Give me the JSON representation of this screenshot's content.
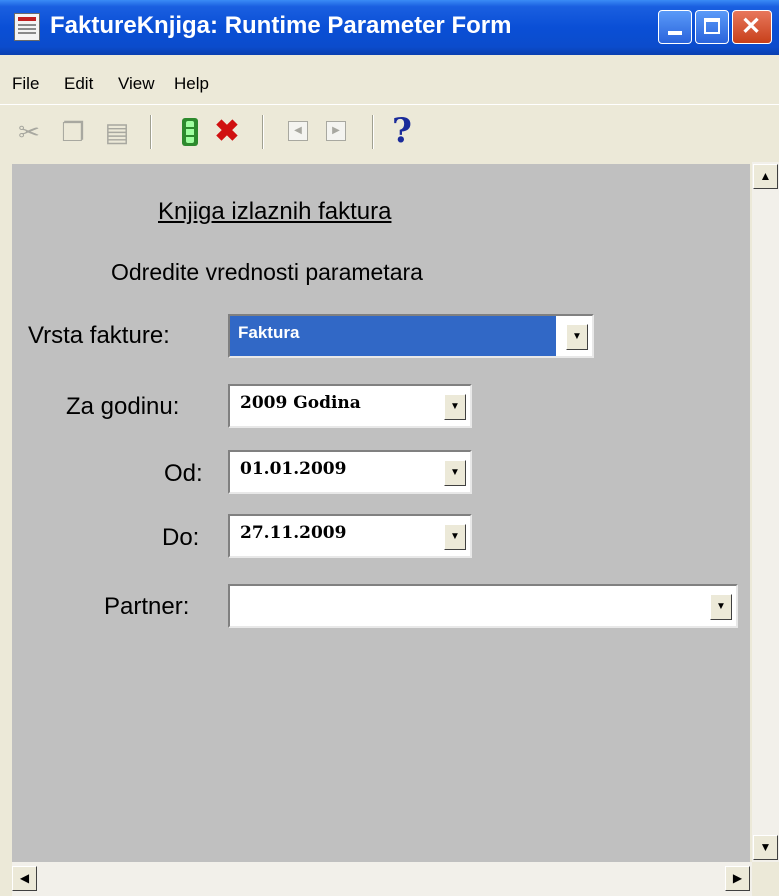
{
  "window": {
    "title": "FaktureKnjiga: Runtime Parameter Form"
  },
  "menu": [
    "File",
    "Edit",
    "View",
    "Help"
  ],
  "icons": {
    "app": "report-app-icon",
    "cut": "scissors-icon",
    "copy": "copy-icon",
    "paste": "paste-icon",
    "run": "traffic-light-icon",
    "cancel": "red-x-icon",
    "prev": "previous-page-icon",
    "next": "next-page-icon",
    "help": "question-mark-icon"
  },
  "form": {
    "heading": "Knjiga izlaznih faktura",
    "subheading": "Odredite vrednosti parametara",
    "fields": [
      {
        "label": "Vrsta fakture:",
        "value": "Faktura"
      },
      {
        "label": "Za godinu:",
        "value": "2009 Godina"
      },
      {
        "label": "Od:",
        "value": "01.01.2009"
      },
      {
        "label": "Do:",
        "value": "27.11.2009"
      },
      {
        "label": "Partner:",
        "value": ""
      }
    ]
  },
  "colors": {
    "titlebar": "#0a4fd6",
    "selection": "#3168c6",
    "client_bg": "#c0c0c0",
    "cancel_red": "#d01010"
  }
}
